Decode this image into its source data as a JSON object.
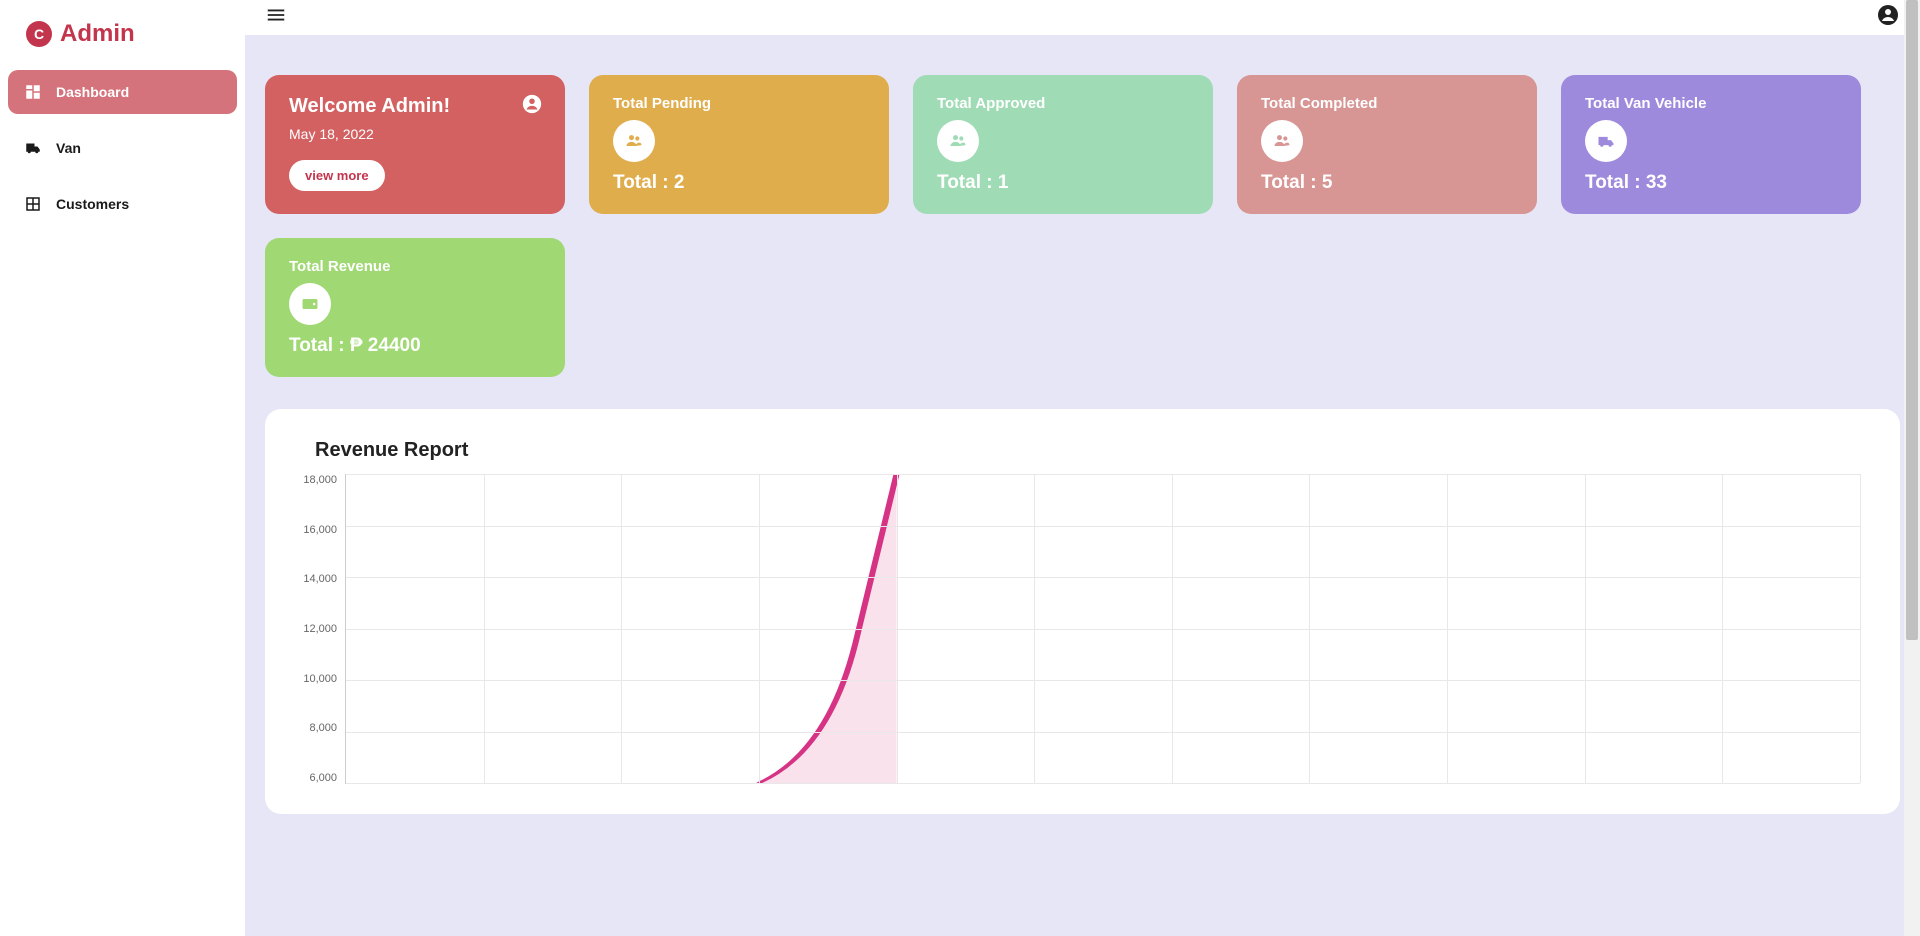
{
  "brand": {
    "name": "Admin"
  },
  "sidebar": {
    "items": [
      {
        "label": "Dashboard",
        "icon": "dashboard",
        "active": true
      },
      {
        "label": "Van",
        "icon": "van",
        "active": false
      },
      {
        "label": "Customers",
        "icon": "customers",
        "active": false
      }
    ]
  },
  "welcome": {
    "title": "Welcome Admin!",
    "date": "May 18, 2022",
    "button": "view more"
  },
  "stats": {
    "pending": {
      "title": "Total Pending",
      "total_label": "Total : 2"
    },
    "approved": {
      "title": "Total Approved",
      "total_label": "Total : 1"
    },
    "completed": {
      "title": "Total Completed",
      "total_label": "Total : 5"
    },
    "van": {
      "title": "Total Van Vehicle",
      "total_label": "Total : 33"
    },
    "revenue": {
      "title": "Total Revenue",
      "total_label": "Total : ₱ 24400"
    }
  },
  "chart_title": "Revenue Report",
  "chart_data": {
    "type": "area",
    "title": "Revenue Report",
    "xlabel": "",
    "ylabel": "",
    "ylim": [
      4000,
      18000
    ],
    "y_ticks": [
      18000,
      16000,
      14000,
      12000,
      10000,
      8000,
      6000
    ],
    "y_tick_labels": [
      "18,000",
      "16,000",
      "14,000",
      "12,000",
      "10,000",
      "8,000",
      "6,000"
    ],
    "x": [
      0,
      1,
      2,
      3,
      4
    ],
    "series": [
      {
        "name": "Revenue",
        "values": [
          null,
          null,
          null,
          4400,
          18000
        ],
        "color": "#d63384",
        "fill": "#f6d5e3"
      }
    ],
    "grid_columns": 11
  }
}
